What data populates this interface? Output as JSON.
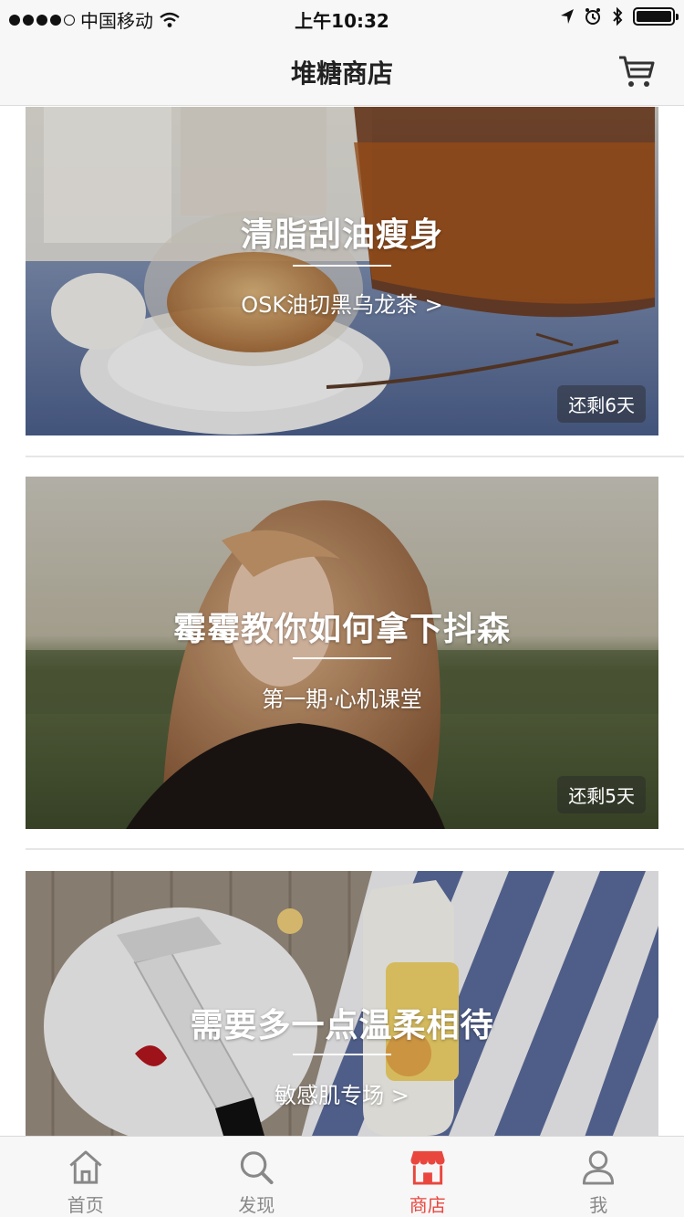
{
  "status_bar": {
    "carrier": "中国移动",
    "time": "上午10:32"
  },
  "header": {
    "title": "堆糖商店",
    "cart_icon": "cart-icon"
  },
  "feed": {
    "cards": [
      {
        "title": "清脂刮油瘦身",
        "subtitle": "OSK油切黑乌龙茶 >",
        "badge": "还剩6天"
      },
      {
        "title": "霉霉教你如何拿下抖森",
        "subtitle": "第一期·心机课堂",
        "badge": "还剩5天"
      },
      {
        "title": "需要多一点温柔相待",
        "subtitle": "敏感肌专场 >"
      }
    ]
  },
  "tab_bar": {
    "active_color": "#e9473e",
    "inactive_color": "#888888",
    "tabs": [
      {
        "label": "首页",
        "icon": "home-icon"
      },
      {
        "label": "发现",
        "icon": "search-icon"
      },
      {
        "label": "商店",
        "icon": "shop-icon"
      },
      {
        "label": "我",
        "icon": "profile-icon"
      }
    ]
  }
}
